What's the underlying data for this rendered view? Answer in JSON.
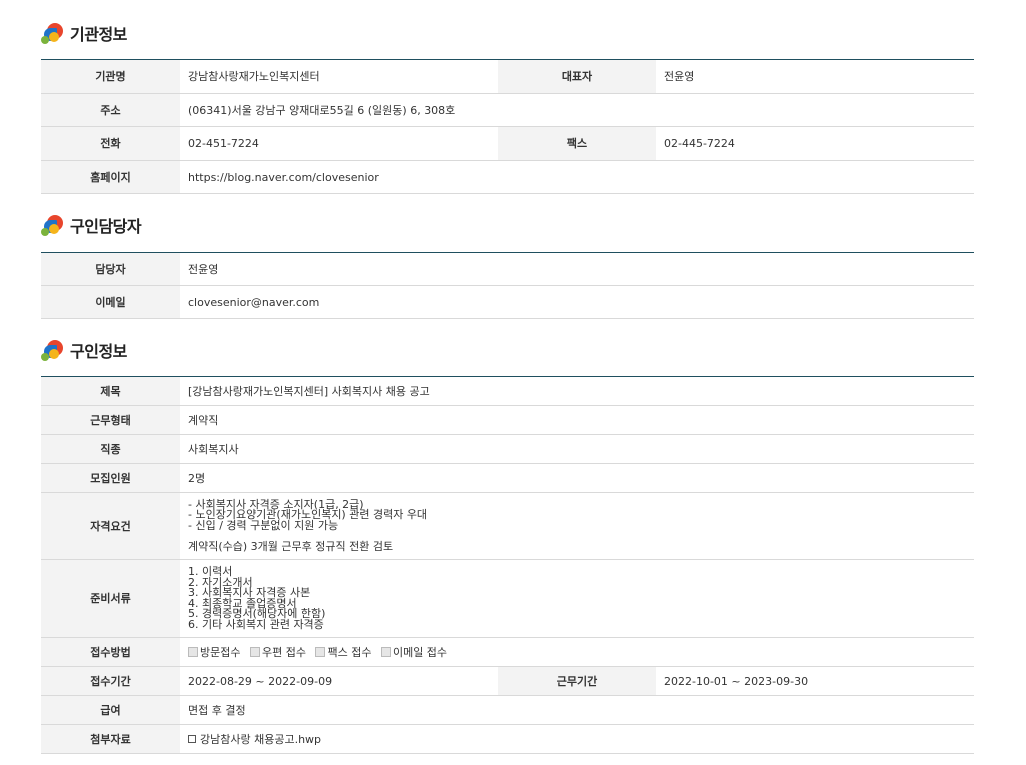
{
  "sections": {
    "org": {
      "title": "기관정보"
    },
    "contact": {
      "title": "구인담당자"
    },
    "job": {
      "title": "구인정보"
    }
  },
  "org": {
    "name_label": "기관명",
    "name": "강남참사랑재가노인복지센터",
    "rep_label": "대표자",
    "rep": "전윤영",
    "address_label": "주소",
    "address": "(06341)서울 강남구 양재대로55길 6 (일원동) 6, 308호",
    "phone_label": "전화",
    "phone": "02-451-7224",
    "fax_label": "팩스",
    "fax": "02-445-7224",
    "homepage_label": "홈페이지",
    "homepage": "https://blog.naver.com/clovesenior"
  },
  "contact": {
    "person_label": "담당자",
    "person": "전윤영",
    "email_label": "이메일",
    "email": "clovesenior@naver.com"
  },
  "job": {
    "title_label": "제목",
    "title": "[강남참사랑재가노인복지센터] 사회복지사 채용 공고",
    "type_label": "근무형태",
    "type": "계약직",
    "occupation_label": "직종",
    "occupation": "사회복지사",
    "count_label": "모집인원",
    "count": "2명",
    "qual_label": "자격요건",
    "qual_lines": [
      "- 사회복지사 자격증 소지자(1급, 2급)",
      "- 노인장기요양기관(재가노인복지) 관련 경력자 우대",
      "- 신입 / 경력 구분없이 지원 가능",
      "",
      "계약직(수습) 3개월 근무후 정규직 전환 검토"
    ],
    "docs_label": "준비서류",
    "docs_lines": [
      "1. 이력서",
      "2. 자기소개서",
      "3. 사회복지사 자격증 사본",
      "4. 최종학교 졸업증명서",
      "5. 경력증명서(해당자에 한함)",
      "6. 기타 사회복지 관련 자격증"
    ],
    "method_label": "접수방법",
    "methods": [
      "방문접수",
      "우편 접수",
      "팩스 접수",
      "이메일 접수"
    ],
    "period_label": "접수기간",
    "period": "2022-08-29 ~ 2022-09-09",
    "work_period_label": "근무기간",
    "work_period": "2022-10-01 ~ 2023-09-30",
    "salary_label": "급여",
    "salary": "면접 후 결정",
    "attach_label": "첨부자료",
    "attach": "강남참사랑 채용공고.hwp"
  }
}
